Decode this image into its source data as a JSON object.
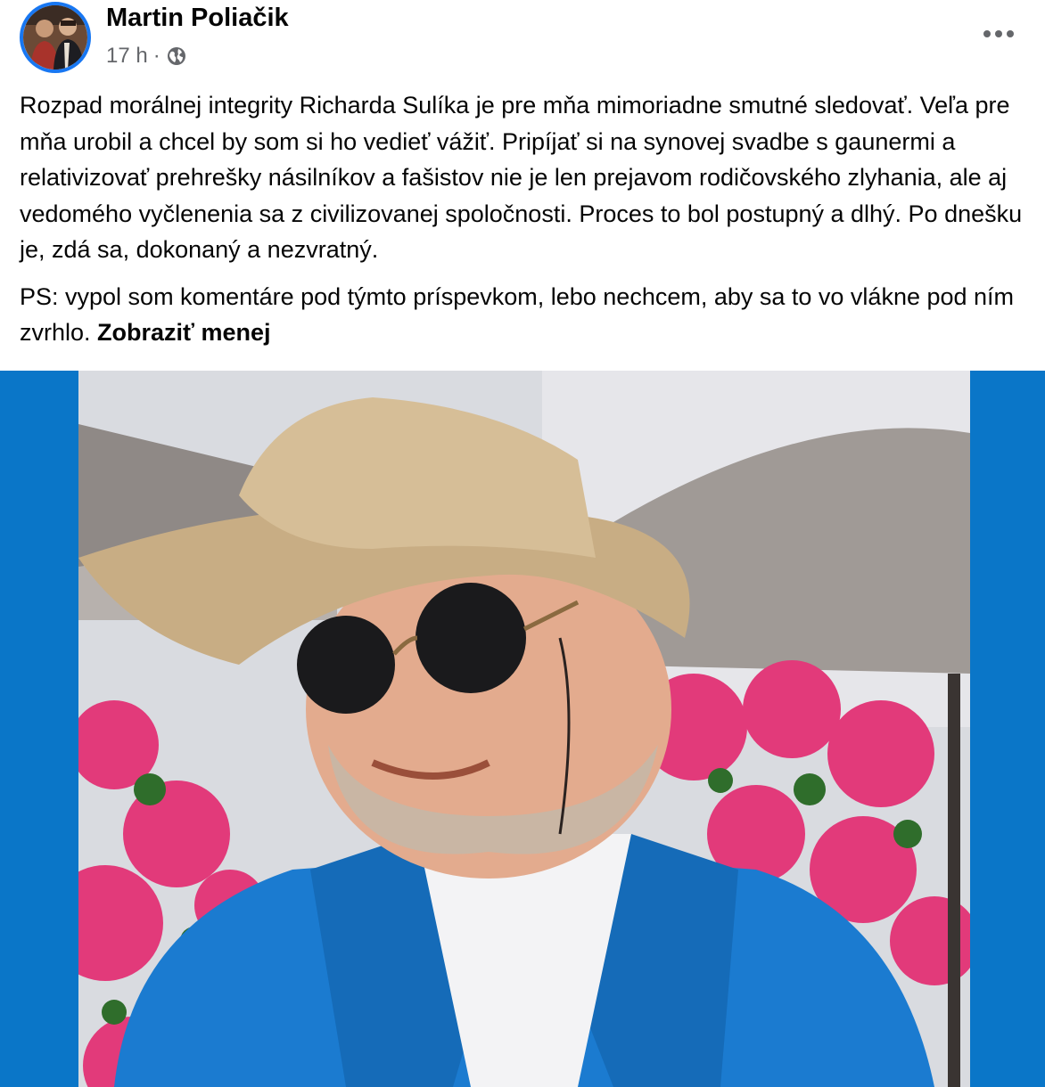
{
  "post": {
    "author": "Martin Poliačik",
    "time": "17 h",
    "separator": "·",
    "audience_icon": "globe-icon",
    "more_icon": "more-horizontal-icon",
    "paragraphs": [
      "Rozpad morálnej integrity Richarda Sulíka je pre mňa mimoriadne smutné sledovať. Veľa pre mňa urobil a chcel by som si ho vedieť vážiť. Pripíjať si na synovej svadbe s gaunermi a relativizovať prehrešky násilníkov a fašistov nie je len prejavom rodičovského zlyhania, ale aj vedomého vyčlenenia sa z civilizovanej spoločnosti. Proces to bol postupný a dlhý. Po dnešku je, zdá sa, dokonaný a nezvratný.",
      "PS: vypol som komentáre pod týmto príspevkom, lebo nechcem, aby sa to vo vlákne pod ním zvrhlo."
    ],
    "see_less": "Zobraziť menej"
  },
  "colors": {
    "accent": "#1877f2",
    "media_background": "#0a76c8",
    "secondary_text": "#65676b"
  }
}
